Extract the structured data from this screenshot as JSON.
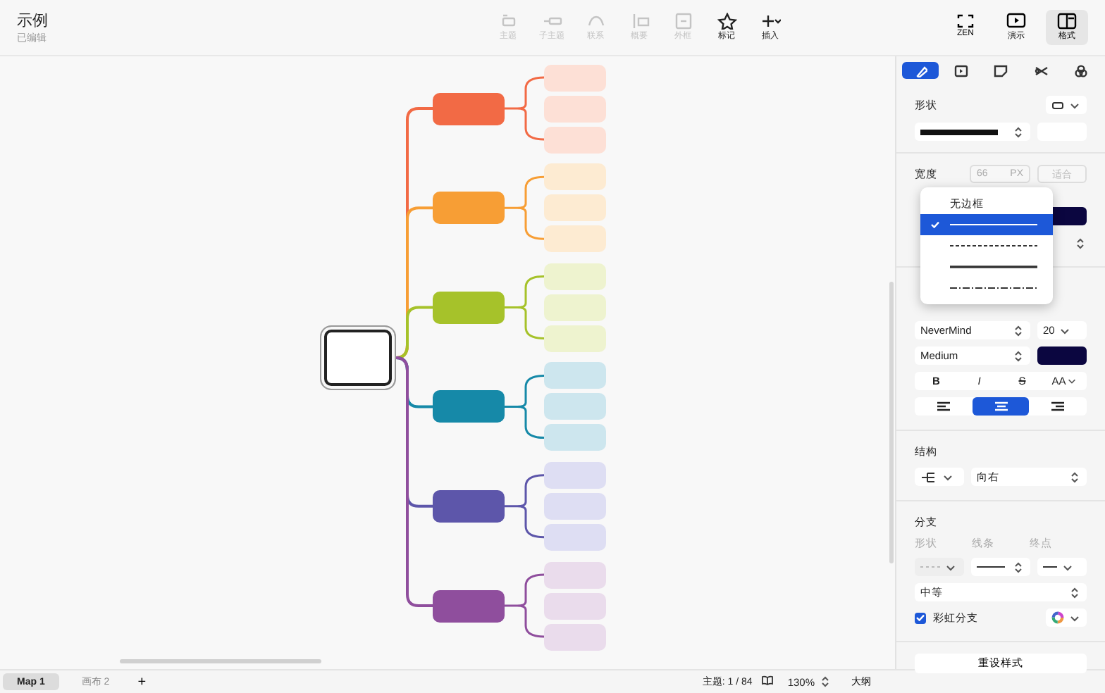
{
  "document": {
    "title": "示例",
    "subtitle": "已编辑"
  },
  "toolbar": [
    {
      "label": "主题",
      "kind": "topic",
      "disabled": true
    },
    {
      "label": "子主题",
      "kind": "subtopic",
      "disabled": true
    },
    {
      "label": "联系",
      "kind": "relation",
      "disabled": true
    },
    {
      "label": "概要",
      "kind": "summary",
      "disabled": true
    },
    {
      "label": "外框",
      "kind": "boundary",
      "disabled": true
    },
    {
      "label": "标记",
      "kind": "star",
      "disabled": false
    },
    {
      "label": "插入",
      "kind": "plus",
      "disabled": false
    }
  ],
  "view_buttons": [
    {
      "label": "ZEN",
      "kind": "zen",
      "selected": false
    },
    {
      "label": "演示",
      "kind": "play",
      "selected": false
    },
    {
      "label": "格式",
      "kind": "panel",
      "selected": true
    }
  ],
  "mind_map": {
    "root": {
      "selected": true
    },
    "branches": [
      {
        "color": "#f26a45",
        "subtopics": [
          {
            "color": "#fde0d6"
          },
          {
            "color": "#fde0d6"
          },
          {
            "color": "#fde0d6"
          }
        ]
      },
      {
        "color": "#f79e35",
        "subtopics": [
          {
            "color": "#fdebd2"
          },
          {
            "color": "#fdebd2"
          },
          {
            "color": "#fdebd2"
          }
        ]
      },
      {
        "color": "#a6c22a",
        "subtopics": [
          {
            "color": "#eef3cf"
          },
          {
            "color": "#eef3cf"
          },
          {
            "color": "#eef3cf"
          }
        ]
      },
      {
        "color": "#1689a8",
        "subtopics": [
          {
            "color": "#cde6ee"
          },
          {
            "color": "#cde6ee"
          },
          {
            "color": "#cde6ee"
          }
        ]
      },
      {
        "color": "#5d56aa",
        "subtopics": [
          {
            "color": "#dedef3"
          },
          {
            "color": "#dedef3"
          },
          {
            "color": "#dedef3"
          }
        ]
      },
      {
        "color": "#8f4e9d",
        "subtopics": [
          {
            "color": "#eadcec"
          },
          {
            "color": "#eadcec"
          },
          {
            "color": "#eadcec"
          }
        ]
      }
    ]
  },
  "panel": {
    "tabs": [
      {
        "kind": "brush",
        "selected": true
      },
      {
        "kind": "frame",
        "selected": false
      },
      {
        "kind": "note",
        "selected": false
      },
      {
        "kind": "scissors",
        "selected": false
      },
      {
        "kind": "circles",
        "selected": false
      }
    ],
    "shape_label": "形状",
    "width_label": "宽度",
    "width_value": "66",
    "width_unit": "PX",
    "fit_button": "适合",
    "border_menu": [
      {
        "kind": "text",
        "label": "无边框",
        "selected": false
      },
      {
        "kind": "solid",
        "selected": true
      },
      {
        "kind": "dashed",
        "selected": false
      },
      {
        "kind": "thick",
        "selected": false
      },
      {
        "kind": "dashdot",
        "selected": false
      }
    ],
    "font": "NeverMind",
    "font_size": "20",
    "font_weight": "Medium",
    "text_styles": [
      {
        "kind": "bold",
        "label": "B"
      },
      {
        "kind": "italic",
        "label": "I"
      },
      {
        "kind": "strike",
        "label": "S"
      },
      {
        "kind": "case",
        "label": "AA"
      }
    ],
    "align": [
      {
        "kind": "left",
        "selected": false
      },
      {
        "kind": "center",
        "selected": true
      },
      {
        "kind": "right",
        "selected": false
      }
    ],
    "structure_label": "结构",
    "direction": "向右",
    "branch_label": "分支",
    "branch_fields": [
      "形状",
      "线条",
      "终点"
    ],
    "thickness": "中等",
    "rainbow": {
      "label": "彩虹分支",
      "checked": true
    },
    "reset_button": "重设样式"
  },
  "bottom_bar": {
    "sheets": [
      {
        "label": "Map 1",
        "selected": true
      },
      {
        "label": "画布 2",
        "selected": false
      }
    ],
    "add": "+",
    "topic_count": "主题: 1 / 84",
    "zoom": "130%",
    "outline": "大纲"
  }
}
